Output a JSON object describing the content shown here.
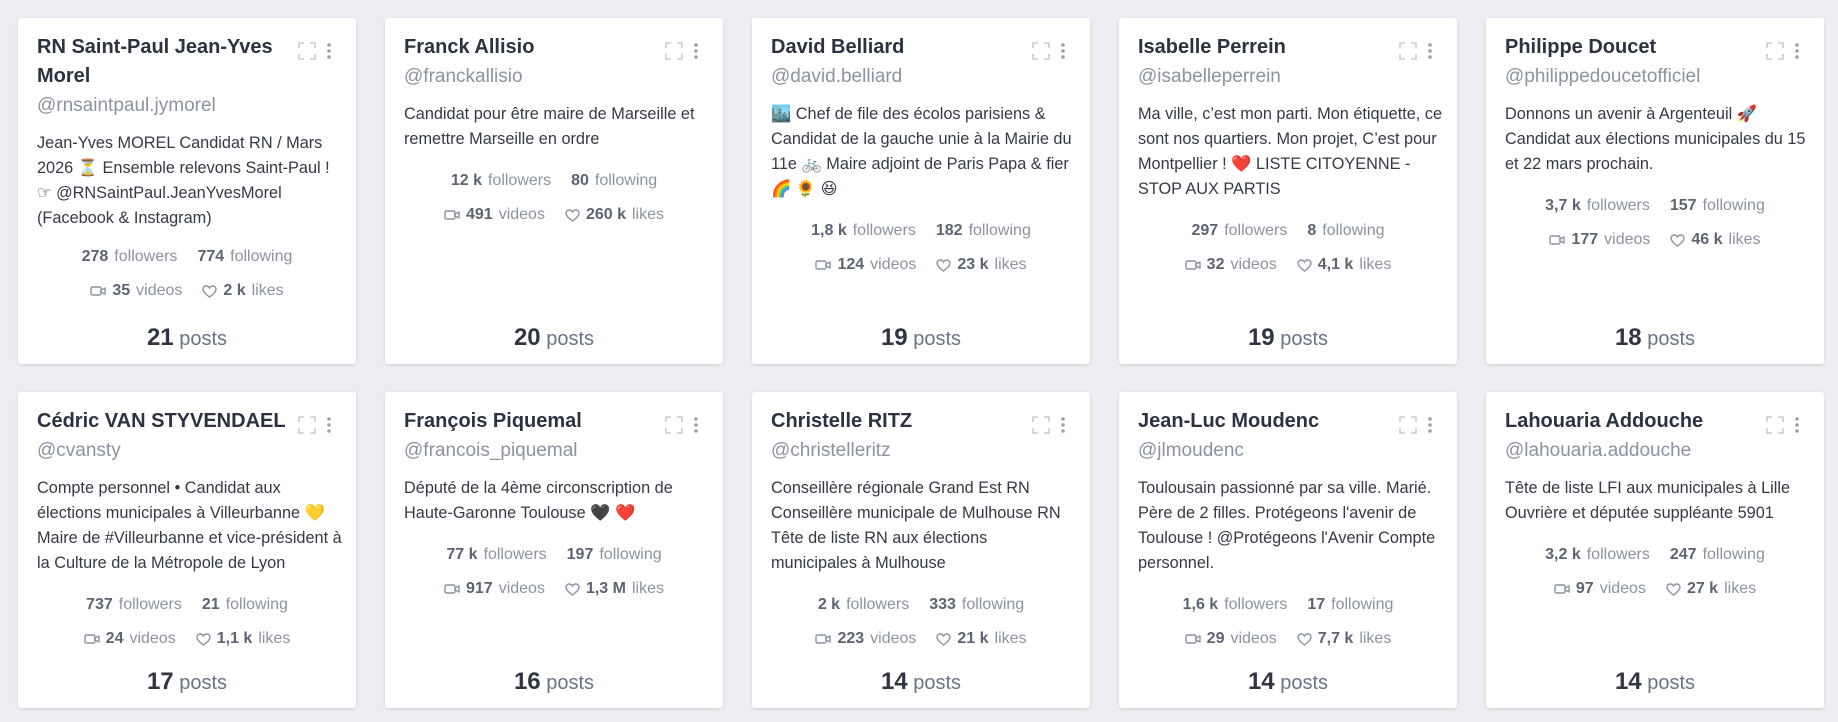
{
  "cards": [
    {
      "name": "RN Saint-Paul Jean-Yves Morel",
      "handle": "@rnsaintpaul.jymorel",
      "bio": "Jean-Yves MOREL Candidat RN / Mars 2026 ⏳ Ensemble relevons Saint-Paul ! ☞ @RNSaintPaul.JeanYvesMorel (Facebook & Instagram)",
      "followers": "278",
      "followers_label": "followers",
      "following": "774",
      "following_label": "following",
      "videos": "35",
      "videos_label": "videos",
      "likes": "2 k",
      "likes_label": "likes",
      "posts": "21",
      "posts_label": "posts"
    },
    {
      "name": "Franck Allisio",
      "handle": "@franckallisio",
      "bio": "Candidat pour être maire de Marseille et remettre Marseille en ordre",
      "followers": "12 k",
      "followers_label": "followers",
      "following": "80",
      "following_label": "following",
      "videos": "491",
      "videos_label": "videos",
      "likes": "260 k",
      "likes_label": "likes",
      "posts": "20",
      "posts_label": "posts"
    },
    {
      "name": "David Belliard",
      "handle": "@david.belliard",
      "bio": "🏙️ Chef de file des écolos parisiens & Candidat de la gauche unie à la Mairie du 11e 🚲 Maire adjoint de Paris Papa & fier 🌈 🌻 😆",
      "followers": "1,8 k",
      "followers_label": "followers",
      "following": "182",
      "following_label": "following",
      "videos": "124",
      "videos_label": "videos",
      "likes": "23 k",
      "likes_label": "likes",
      "posts": "19",
      "posts_label": "posts"
    },
    {
      "name": "Isabelle Perrein",
      "handle": "@isabelleperrein",
      "bio": "Ma ville, c’est mon parti. Mon étiquette, ce sont nos quartiers. Mon projet, C’est pour Montpellier ! ❤️ LISTE CITOYENNE - STOP AUX PARTIS",
      "followers": "297",
      "followers_label": "followers",
      "following": "8",
      "following_label": "following",
      "videos": "32",
      "videos_label": "videos",
      "likes": "4,1 k",
      "likes_label": "likes",
      "posts": "19",
      "posts_label": "posts"
    },
    {
      "name": "Philippe Doucet",
      "handle": "@philippedoucetofficiel",
      "bio": "Donnons un avenir à Argenteuil 🚀 Candidat aux élections municipales du 15 et 22 mars prochain.",
      "followers": "3,7 k",
      "followers_label": "followers",
      "following": "157",
      "following_label": "following",
      "videos": "177",
      "videos_label": "videos",
      "likes": "46 k",
      "likes_label": "likes",
      "posts": "18",
      "posts_label": "posts"
    },
    {
      "name": "Cédric VAN STYVENDAEL",
      "handle": "@cvansty",
      "bio": "Compte personnel • Candidat aux élections municipales à Villeurbanne 💛 Maire de #Villeurbanne et vice-président à la Culture de la Métropole de Lyon",
      "followers": "737",
      "followers_label": "followers",
      "following": "21",
      "following_label": "following",
      "videos": "24",
      "videos_label": "videos",
      "likes": "1,1 k",
      "likes_label": "likes",
      "posts": "17",
      "posts_label": "posts"
    },
    {
      "name": "François Piquemal",
      "handle": "@francois_piquemal",
      "bio": "Député de la 4ème circonscription de Haute-Garonne Toulouse 🖤 ❤️",
      "followers": "77 k",
      "followers_label": "followers",
      "following": "197",
      "following_label": "following",
      "videos": "917",
      "videos_label": "videos",
      "likes": "1,3 M",
      "likes_label": "likes",
      "posts": "16",
      "posts_label": "posts"
    },
    {
      "name": "Christelle RITZ",
      "handle": "@christelleritz",
      "bio": "Conseillère régionale Grand Est RN Conseillère municipale de Mulhouse RN Tête de liste RN aux élections municipales à Mulhouse",
      "followers": "2 k",
      "followers_label": "followers",
      "following": "333",
      "following_label": "following",
      "videos": "223",
      "videos_label": "videos",
      "likes": "21 k",
      "likes_label": "likes",
      "posts": "14",
      "posts_label": "posts"
    },
    {
      "name": "Jean-Luc Moudenc",
      "handle": "@jlmoudenc",
      "bio": "Toulousain passionné par sa ville. Marié. Père de 2 filles. Protégeons l'avenir de Toulouse ! @Protégeons l'Avenir Compte personnel.",
      "followers": "1,6 k",
      "followers_label": "followers",
      "following": "17",
      "following_label": "following",
      "videos": "29",
      "videos_label": "videos",
      "likes": "7,7 k",
      "likes_label": "likes",
      "posts": "14",
      "posts_label": "posts"
    },
    {
      "name": "Lahouaria Addouche",
      "handle": "@lahouaria.addouche",
      "bio": "Tête de liste LFI aux municipales à Lille Ouvrière et députée suppléante 5901",
      "followers": "3,2 k",
      "followers_label": "followers",
      "following": "247",
      "following_label": "following",
      "videos": "97",
      "videos_label": "videos",
      "likes": "27 k",
      "likes_label": "likes",
      "posts": "14",
      "posts_label": "posts"
    }
  ]
}
